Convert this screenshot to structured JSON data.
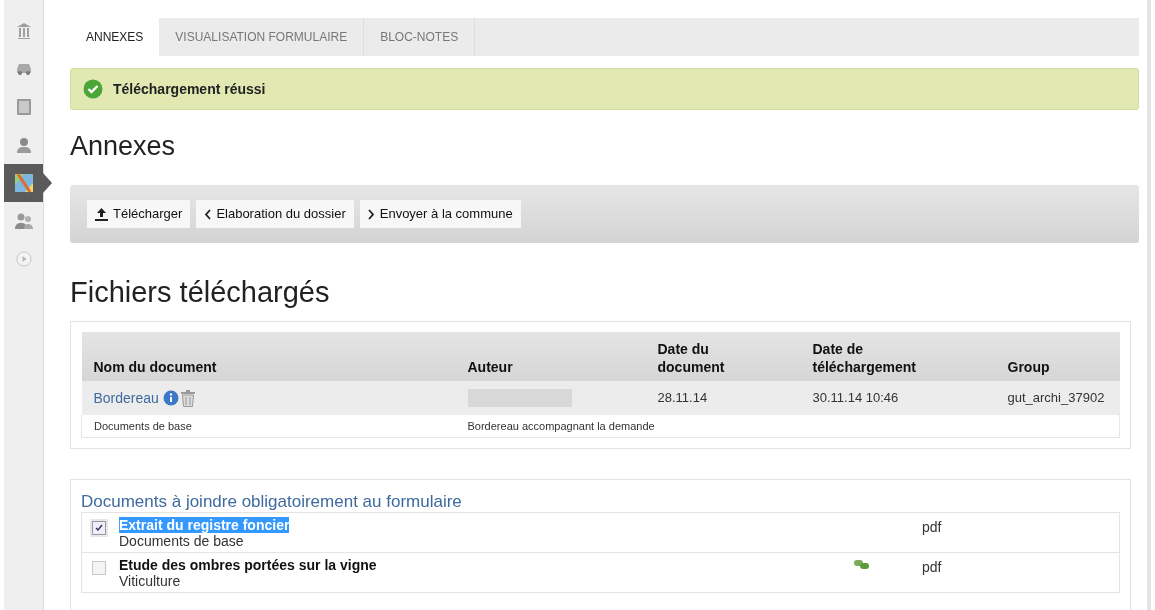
{
  "sidebar": {
    "items": [
      {
        "kind": "library",
        "selected": false
      },
      {
        "kind": "car",
        "selected": false
      },
      {
        "kind": "document",
        "selected": false
      },
      {
        "kind": "person",
        "selected": false
      },
      {
        "kind": "map",
        "selected": true
      },
      {
        "kind": "people",
        "selected": false
      },
      {
        "kind": "play",
        "selected": false
      }
    ]
  },
  "tabs": [
    {
      "label": "ANNEXES",
      "selected": true
    },
    {
      "label": "VISUALISATION FORMULAIRE",
      "selected": false
    },
    {
      "label": "BLOC-NOTES",
      "selected": false
    }
  ],
  "alert": {
    "kind": "success",
    "text": "Téléchargement réussi"
  },
  "title": "Annexes",
  "toolbar": [
    {
      "kind": "upload",
      "label": "Télécharger"
    },
    {
      "kind": "back",
      "label": "Elaboration du dossier"
    },
    {
      "kind": "forward",
      "label": "Envoyer à la commune"
    }
  ],
  "files_section": {
    "title": "Fichiers téléchargés",
    "table": {
      "columns": [
        {
          "label": "Nom du document"
        },
        {
          "label": "Auteur"
        },
        {
          "label": "Date du\ndocument"
        },
        {
          "label": "Date de\ntéléchargement"
        },
        {
          "label": "Group"
        }
      ],
      "rows": [
        {
          "name": "Bordereau",
          "author_redacted": true,
          "document_date": "28.11.14",
          "upload_date": "30.11.14 10:46",
          "group": "gut_archi_37902",
          "category": "Documents de base",
          "description": "Bordereau accompagnant la demande"
        }
      ]
    }
  },
  "required_section": {
    "title": "Documents à joindre obligatoirement au formulaire",
    "items": [
      {
        "name": "Extrait du registre foncier",
        "category": "Documents de base",
        "type": "pdf",
        "checked": true,
        "highlighted": true,
        "has_link": false
      },
      {
        "name": "Etude des ombres portées sur la vigne",
        "category": "Viticulture",
        "type": "pdf",
        "checked": false,
        "highlighted": false,
        "has_link": true
      }
    ]
  }
}
